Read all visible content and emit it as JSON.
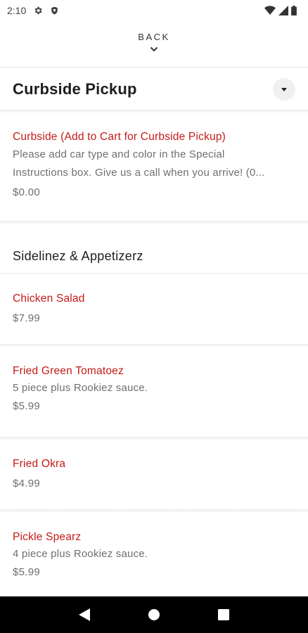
{
  "status_bar": {
    "time": "2:10",
    "left_icons": [
      "gear-icon",
      "shield-icon"
    ],
    "right_icons": [
      "wifi-icon",
      "signal-icon",
      "battery-icon"
    ]
  },
  "back": {
    "label": "BACK"
  },
  "section": {
    "title": "Curbside Pickup"
  },
  "curbside_item": {
    "name": "Curbside (Add to Cart for Curbside Pickup)",
    "description_line1": "Please add car type and color in the Special",
    "description_line2": "Instructions box. Give us a call when you arrive! (0...",
    "price": "$0.00"
  },
  "category": {
    "title": "Sidelinez & Appetizerz"
  },
  "items": [
    {
      "name": "Chicken Salad",
      "description": "",
      "price": "$7.99"
    },
    {
      "name": "Fried Green Tomatoez",
      "description": "5 piece plus Rookiez sauce.",
      "price": "$5.99"
    },
    {
      "name": "Fried Okra",
      "description": "",
      "price": "$4.99"
    },
    {
      "name": "Pickle Spearz",
      "description": "4 piece plus Rookiez sauce.",
      "price": "$5.99"
    }
  ],
  "colors": {
    "accent_red": "#c41a17",
    "text_gray": "#6f6f6f",
    "nav_bar": "#000000"
  },
  "nav_bar": {
    "buttons": [
      "back-triangle-icon",
      "home-circle-icon",
      "recents-square-icon"
    ]
  }
}
